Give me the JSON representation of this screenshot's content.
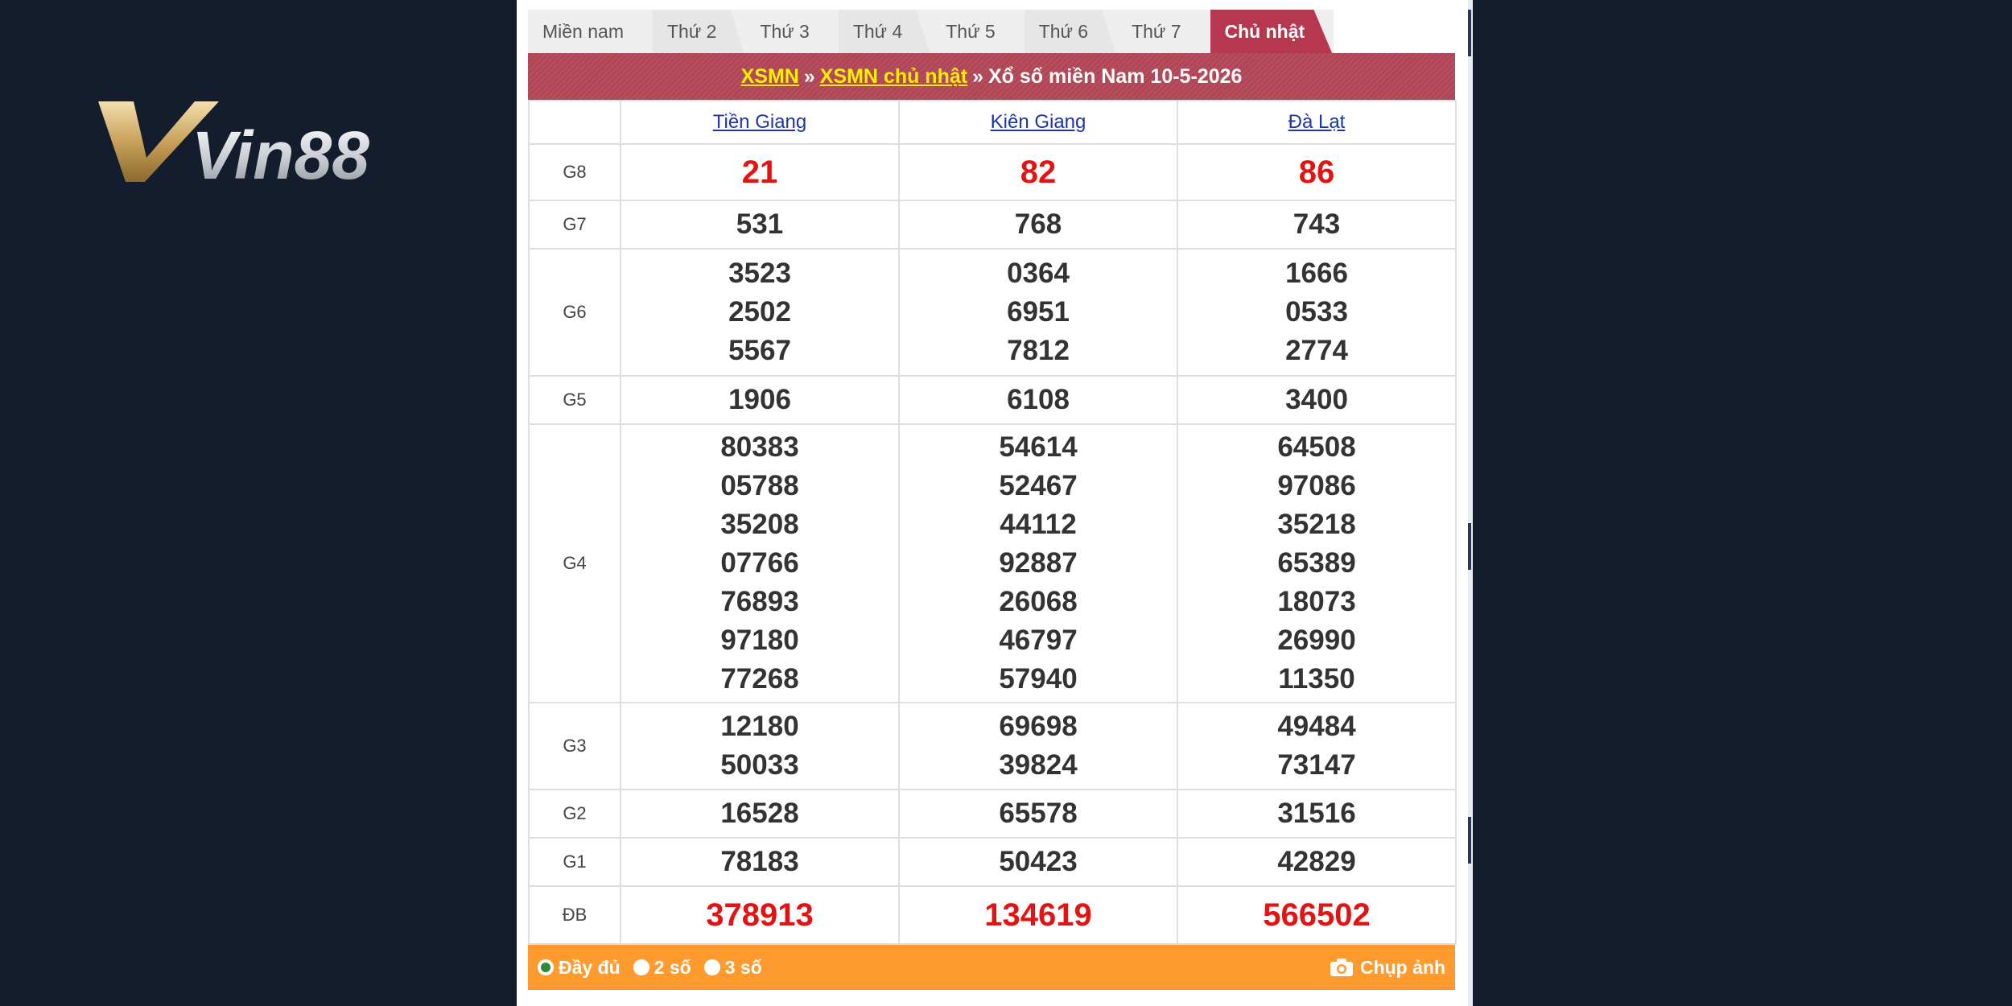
{
  "logo": {
    "text": "Vin88",
    "name": "vin88-logo"
  },
  "tabs": [
    {
      "label": "Miền nam",
      "active": false
    },
    {
      "label": "Thứ 2",
      "active": false
    },
    {
      "label": "Thứ 3",
      "active": false
    },
    {
      "label": "Thứ 4",
      "active": false
    },
    {
      "label": "Thứ 5",
      "active": false
    },
    {
      "label": "Thứ 6",
      "active": false
    },
    {
      "label": "Thứ 7",
      "active": false
    },
    {
      "label": "Chủ nhật",
      "active": true
    }
  ],
  "breadcrumb": {
    "link1": "XSMN",
    "sep1": "»",
    "link2": "XSMN chủ nhật",
    "sep2": "»",
    "title": "Xổ số miền Nam 10-5-2026"
  },
  "provinces": [
    "Tiền Giang",
    "Kiên Giang",
    "Đà Lạt"
  ],
  "prizes": [
    {
      "label": "G8",
      "highlight": true,
      "values": [
        [
          "21"
        ],
        [
          "82"
        ],
        [
          "86"
        ]
      ]
    },
    {
      "label": "G7",
      "highlight": false,
      "values": [
        [
          "531"
        ],
        [
          "768"
        ],
        [
          "743"
        ]
      ]
    },
    {
      "label": "G6",
      "highlight": false,
      "values": [
        [
          "3523",
          "2502",
          "5567"
        ],
        [
          "0364",
          "6951",
          "7812"
        ],
        [
          "1666",
          "0533",
          "2774"
        ]
      ]
    },
    {
      "label": "G5",
      "highlight": false,
      "values": [
        [
          "1906"
        ],
        [
          "6108"
        ],
        [
          "3400"
        ]
      ]
    },
    {
      "label": "G4",
      "highlight": false,
      "values": [
        [
          "80383",
          "05788",
          "35208",
          "07766",
          "76893",
          "97180",
          "77268"
        ],
        [
          "54614",
          "52467",
          "44112",
          "92887",
          "26068",
          "46797",
          "57940"
        ],
        [
          "64508",
          "97086",
          "35218",
          "65389",
          "18073",
          "26990",
          "11350"
        ]
      ]
    },
    {
      "label": "G3",
      "highlight": false,
      "values": [
        [
          "12180",
          "50033"
        ],
        [
          "69698",
          "39824"
        ],
        [
          "49484",
          "73147"
        ]
      ]
    },
    {
      "label": "G2",
      "highlight": false,
      "values": [
        [
          "16528"
        ],
        [
          "65578"
        ],
        [
          "31516"
        ]
      ]
    },
    {
      "label": "G1",
      "highlight": false,
      "values": [
        [
          "78183"
        ],
        [
          "50423"
        ],
        [
          "42829"
        ]
      ]
    },
    {
      "label": "ĐB",
      "highlight": true,
      "values": [
        [
          "378913"
        ],
        [
          "134619"
        ],
        [
          "566502"
        ]
      ]
    }
  ],
  "bottom": {
    "options": [
      {
        "label": "Đầy đủ",
        "checked": true
      },
      {
        "label": "2 số",
        "checked": false
      },
      {
        "label": "3 số",
        "checked": false
      }
    ],
    "capture_label": "Chụp ảnh"
  },
  "colors": {
    "background": "#141d2d",
    "title_bar": "#b04556",
    "active_tab": "#b5384f",
    "link_yellow": "#ffee00",
    "province_link": "#1d35a8",
    "highlight_red": "#e31313",
    "bottom_bar": "#ff9a2e"
  }
}
